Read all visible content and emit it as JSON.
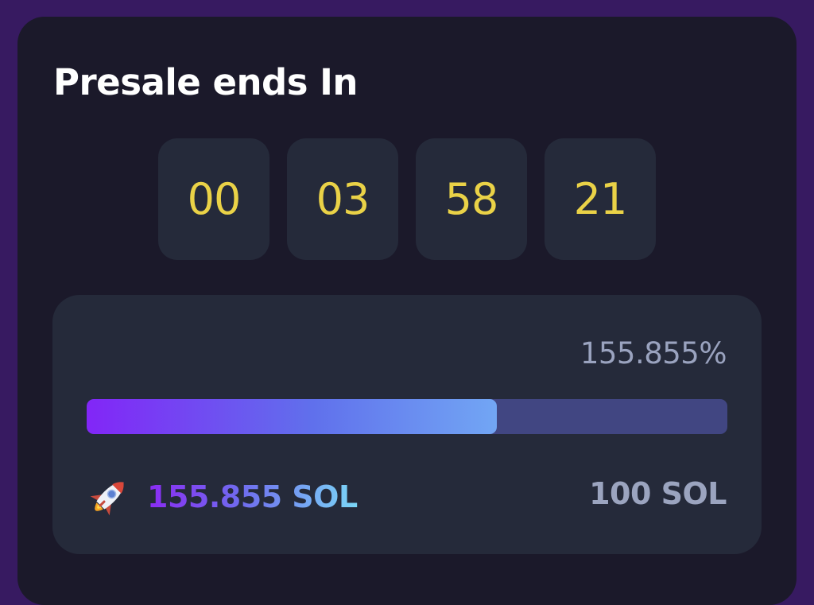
{
  "presale": {
    "title": "Presale ends In",
    "countdown": [
      "00",
      "03",
      "58",
      "21"
    ]
  },
  "progress": {
    "percent_label": "155.855%",
    "bar_fill_fraction": 0.64,
    "raised_label": "155.855 SOL",
    "goal_label": "100 SOL",
    "raised_icon": "rocket-icon"
  },
  "colors": {
    "page_background": "#371a61",
    "card_background": "#1b192a",
    "panel_background": "#252a3a",
    "countdown_digits": "#ead247",
    "bar_track": "#414682",
    "bar_gradient_start": "#8226f7",
    "bar_gradient_end": "#72a6f4",
    "muted_text": "#9aa3bf"
  }
}
